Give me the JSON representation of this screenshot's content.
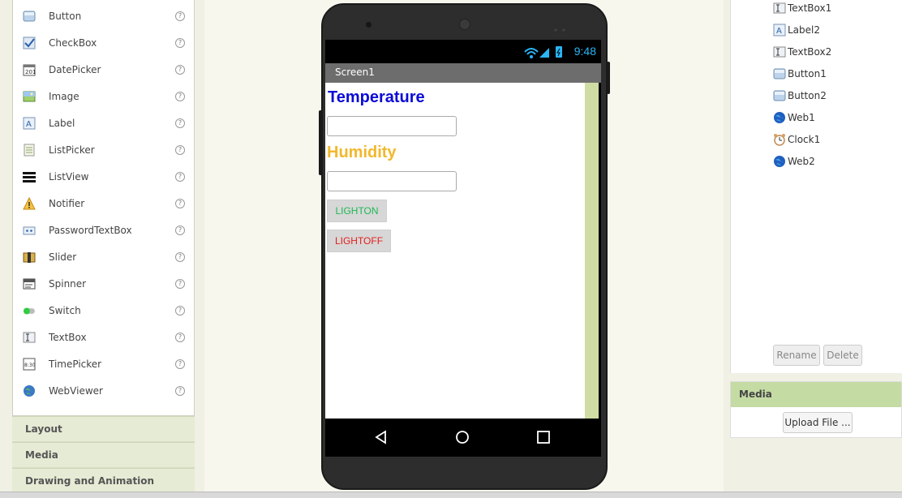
{
  "palette": {
    "items": [
      {
        "label": "Button",
        "icon": "button-icon"
      },
      {
        "label": "CheckBox",
        "icon": "checkbox-icon"
      },
      {
        "label": "DatePicker",
        "icon": "datepicker-icon"
      },
      {
        "label": "Image",
        "icon": "image-icon"
      },
      {
        "label": "Label",
        "icon": "label-icon"
      },
      {
        "label": "ListPicker",
        "icon": "listpicker-icon"
      },
      {
        "label": "ListView",
        "icon": "listview-icon"
      },
      {
        "label": "Notifier",
        "icon": "notifier-icon"
      },
      {
        "label": "PasswordTextBox",
        "icon": "password-icon"
      },
      {
        "label": "Slider",
        "icon": "slider-icon"
      },
      {
        "label": "Spinner",
        "icon": "spinner-icon"
      },
      {
        "label": "Switch",
        "icon": "switch-icon"
      },
      {
        "label": "TextBox",
        "icon": "textbox-icon"
      },
      {
        "label": "TimePicker",
        "icon": "timepicker-icon"
      },
      {
        "label": "WebViewer",
        "icon": "webviewer-icon"
      }
    ],
    "help_glyph": "?",
    "drawers": [
      "Layout",
      "Media",
      "Drawing and Animation"
    ]
  },
  "phone": {
    "time": "9:48",
    "screen_title": "Screen1",
    "label_temperature": "Temperature",
    "label_humidity": "Humidity",
    "button_on": "LIGHTON",
    "button_off": "LIGHTOFF",
    "colors": {
      "temperature": "#0b0bd6",
      "humidity": "#f2b82c",
      "on": "#1db954",
      "off": "#e0201c",
      "statusbar_accent": "#29b6f6"
    }
  },
  "components": {
    "items": [
      {
        "label": "TextBox1",
        "icon": "textbox-icon"
      },
      {
        "label": "Label2",
        "icon": "label-icon"
      },
      {
        "label": "TextBox2",
        "icon": "textbox-icon"
      },
      {
        "label": "Button1",
        "icon": "button-icon"
      },
      {
        "label": "Button2",
        "icon": "button-icon"
      },
      {
        "label": "Web1",
        "icon": "web-icon"
      },
      {
        "label": "Clock1",
        "icon": "clock-icon"
      },
      {
        "label": "Web2",
        "icon": "web-icon"
      }
    ],
    "rename": "Rename",
    "delete": "Delete"
  },
  "media": {
    "title": "Media",
    "upload": "Upload File ..."
  }
}
